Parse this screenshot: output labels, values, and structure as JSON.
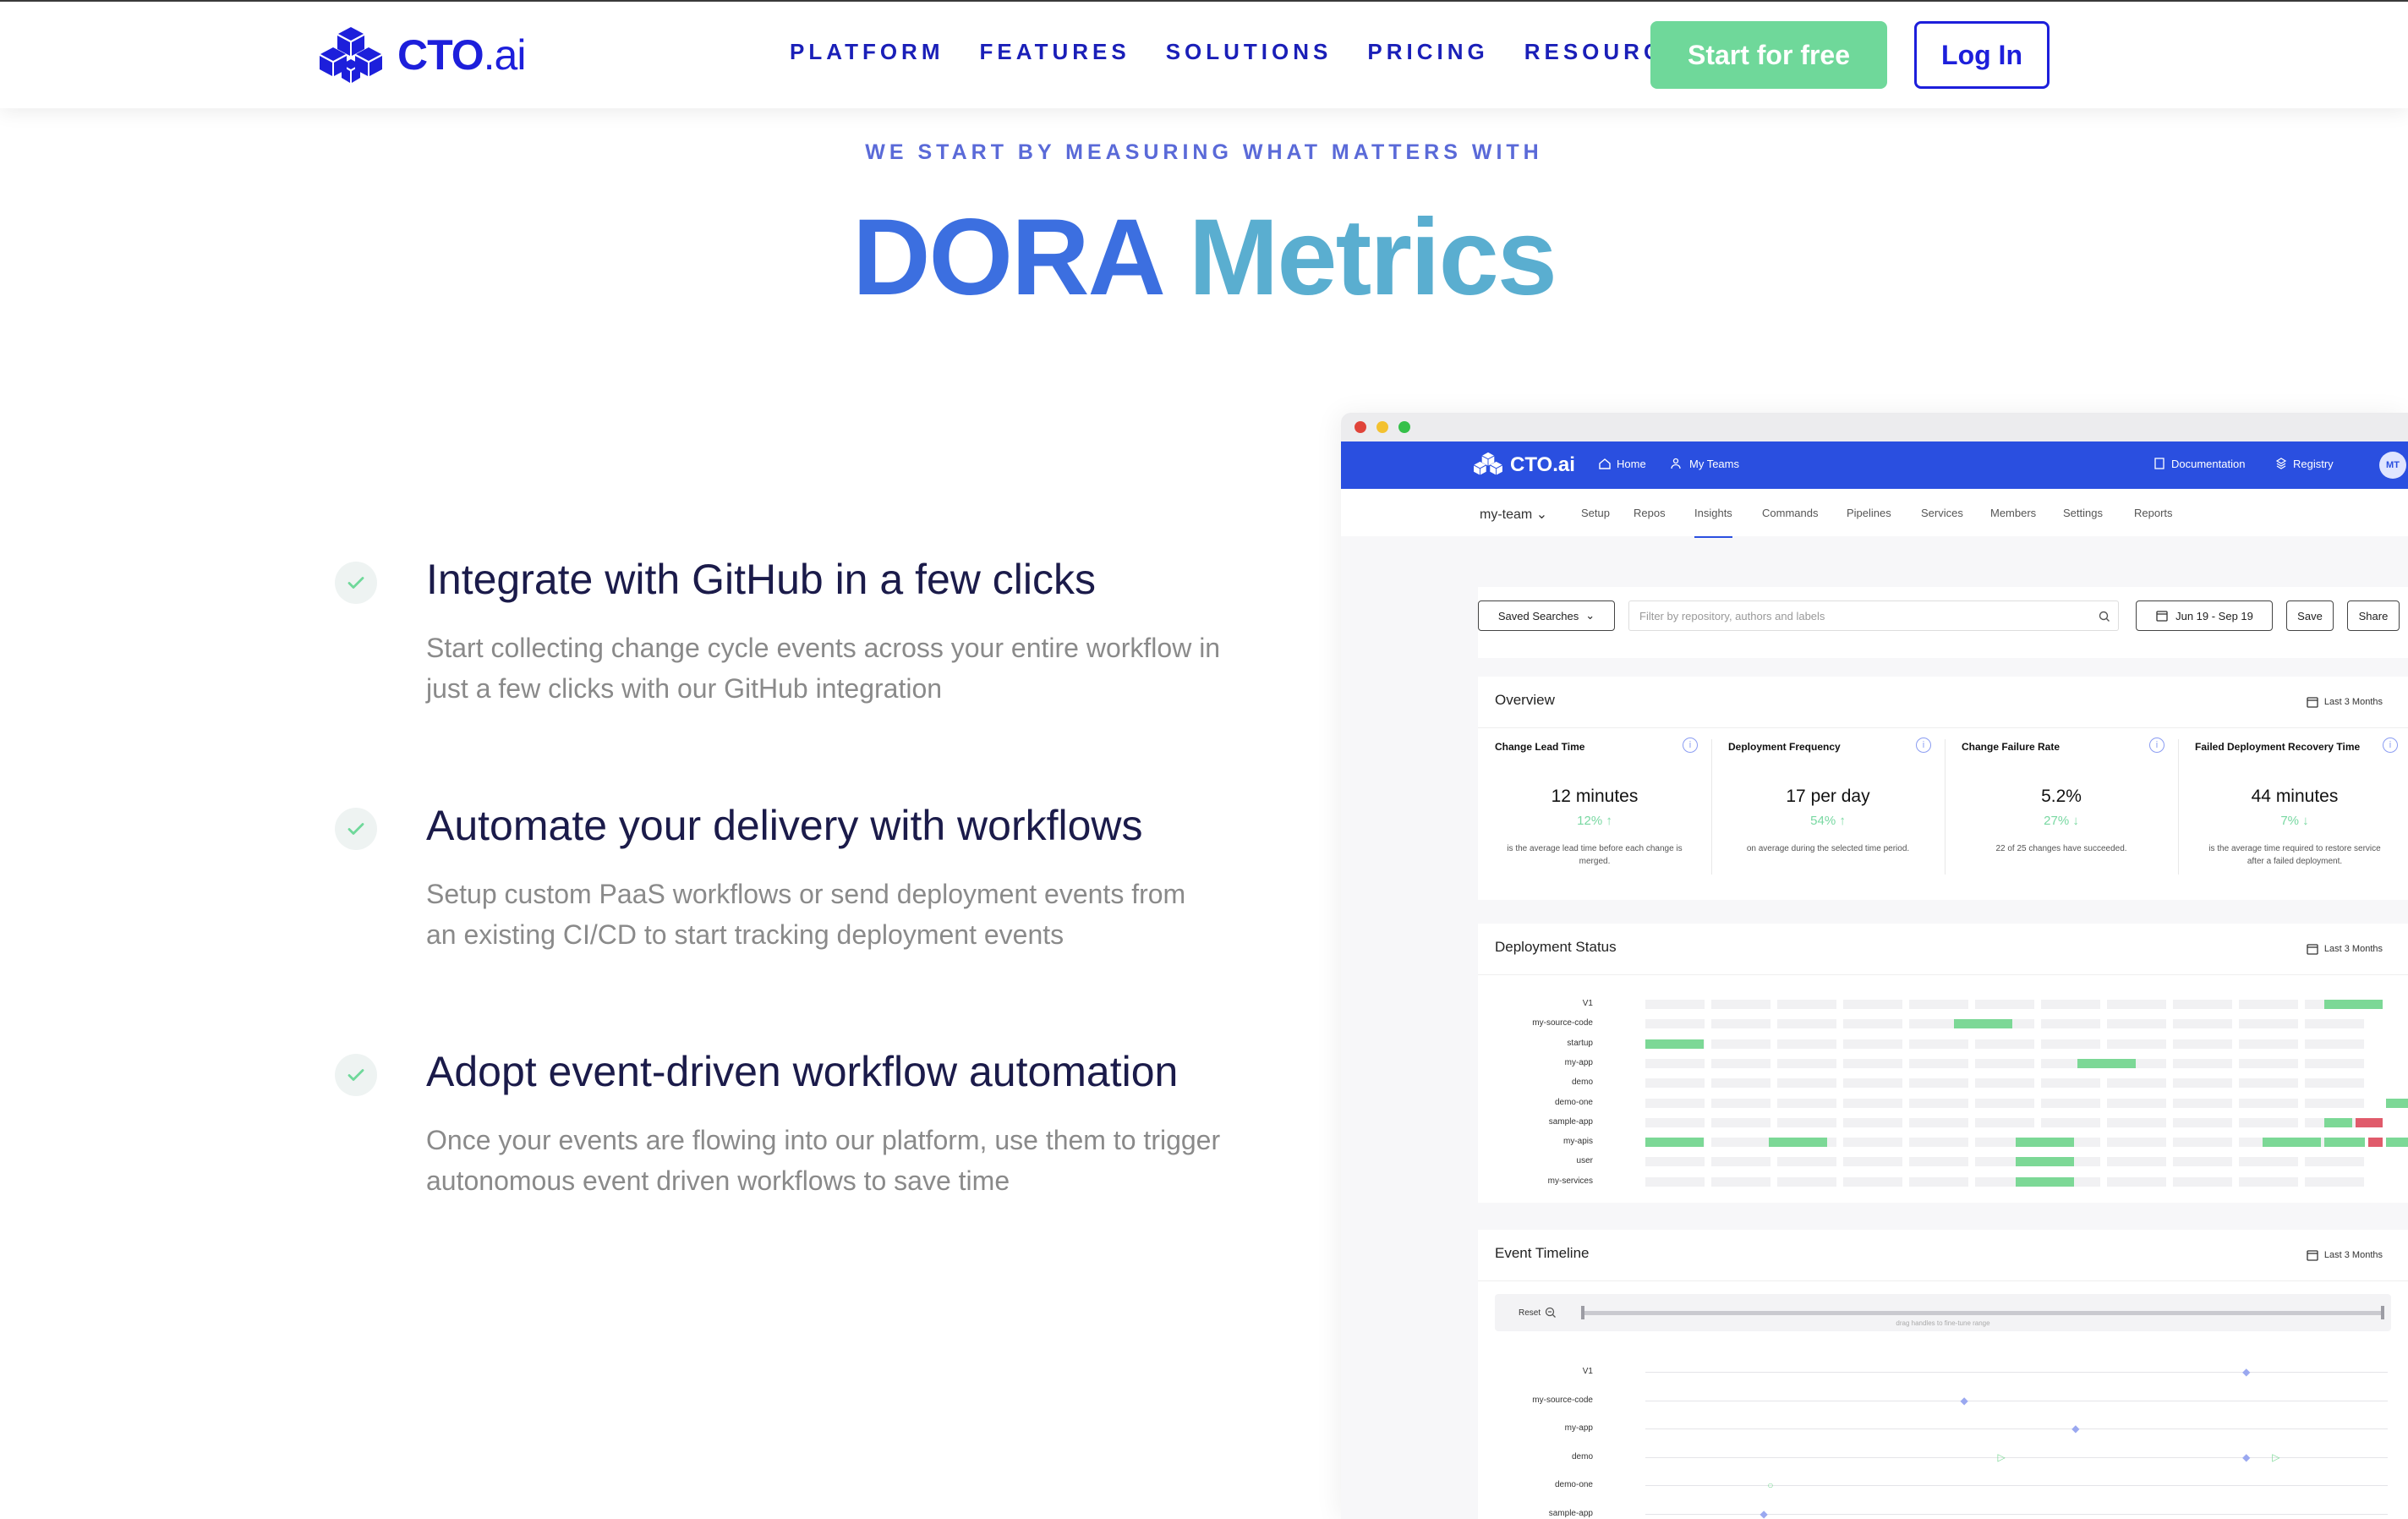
{
  "nav": {
    "logo_main": "CTO",
    "logo_suffix": ".ai",
    "links": [
      "PLATFORM",
      "FEATURES",
      "SOLUTIONS",
      "PRICING",
      "RESOURCES"
    ],
    "start_label": "Start for free",
    "login_label": "Log In",
    "accent": "#1d1fdb",
    "start_color": "#6fd89a"
  },
  "hero": {
    "eyebrow": "WE START BY MEASURING WHAT MATTERS WITH",
    "title_part1": "DORA",
    "title_part2": "Metrics"
  },
  "features": [
    {
      "icon": "check-icon",
      "title": "Integrate with GitHub in a few clicks",
      "desc": "Start collecting change cycle events across your entire workflow in just a few clicks with our GitHub integration"
    },
    {
      "icon": "check-icon",
      "title": "Automate your delivery with workflows",
      "desc": "Setup custom PaaS workflows or send deployment events from an existing CI/CD to start tracking deployment events"
    },
    {
      "icon": "check-icon",
      "title": "Adopt event-driven workflow automation",
      "desc": "Once your events are flowing into our platform, use them to trigger autonomous event driven workflows to save time"
    }
  ],
  "app": {
    "logo": "CTO.ai",
    "top_nav": {
      "home": "Home",
      "my_teams": "My Teams",
      "documentation": "Documentation",
      "registry": "Registry",
      "avatar": "MT"
    },
    "team": "my-team",
    "tabs": [
      "Setup",
      "Repos",
      "Insights",
      "Commands",
      "Pipelines",
      "Services",
      "Members",
      "Settings",
      "Reports"
    ],
    "active_tab": "Insights",
    "filters": {
      "saved_searches": "Saved Searches",
      "placeholder": "Filter by repository, authors and labels",
      "date_range": "Jun 19 - Sep 19",
      "save": "Save",
      "share": "Share"
    },
    "overview": {
      "title": "Overview",
      "range": "Last 3 Months",
      "metrics": [
        {
          "label": "Change Lead Time",
          "value": "12 minutes",
          "delta": "12%",
          "dir": "up",
          "note": "is the average lead time before each change is merged."
        },
        {
          "label": "Deployment Frequency",
          "value": "17 per day",
          "delta": "54%",
          "dir": "up",
          "note": "on average during the selected time period."
        },
        {
          "label": "Change Failure Rate",
          "value": "5.2%",
          "delta": "27%",
          "dir": "down",
          "note": "22 of 25 changes have succeeded."
        },
        {
          "label": "Failed Deployment Recovery Time",
          "value": "44 minutes",
          "delta": "7%",
          "dir": "down",
          "note": "is the average time required to restore service after a failed deployment."
        }
      ]
    },
    "deployment_status": {
      "title": "Deployment Status",
      "range": "Last 3 Months",
      "colors": {
        "success": "#7cd896",
        "failure": "#e05b6b"
      },
      "rows": [
        {
          "label": "V1",
          "bars": [
            [
              11,
              12,
              "success"
            ]
          ]
        },
        {
          "label": "my-source-code",
          "bars": [
            [
              5,
              6,
              "success"
            ]
          ]
        },
        {
          "label": "startup",
          "bars": [
            [
              0,
              1,
              "success"
            ]
          ]
        },
        {
          "label": "my-app",
          "bars": [
            [
              7,
              8,
              "success"
            ]
          ]
        },
        {
          "label": "demo",
          "bars": []
        },
        {
          "label": "demo-one",
          "bars": [
            [
              12,
              13,
              "success"
            ]
          ]
        },
        {
          "label": "sample-app",
          "bars": [
            [
              11,
              11.5,
              "success"
            ],
            [
              11.5,
              12,
              "failure"
            ]
          ]
        },
        {
          "label": "my-apis",
          "bars": [
            [
              0,
              1,
              "success"
            ],
            [
              2,
              3,
              "success"
            ],
            [
              6,
              7,
              "success"
            ],
            [
              10,
              11,
              "success"
            ],
            [
              11,
              11.7,
              "success"
            ],
            [
              11.7,
              12,
              "failure"
            ],
            [
              12,
              13,
              "success"
            ]
          ]
        },
        {
          "label": "user",
          "bars": [
            [
              6,
              7,
              "success"
            ]
          ]
        },
        {
          "label": "my-services",
          "bars": [
            [
              6,
              7,
              "success"
            ]
          ]
        }
      ]
    },
    "event_timeline": {
      "title": "Event Timeline",
      "range": "Last 3 Months",
      "reset": "Reset",
      "hint": "drag handles to fine-tune range",
      "rows": [
        {
          "label": "V1",
          "markers": [
            [
              0.81,
              "diamond",
              "#9aa8f0"
            ]
          ]
        },
        {
          "label": "my-source-code",
          "markers": [
            [
              0.43,
              "diamond",
              "#9aa8f0"
            ]
          ]
        },
        {
          "label": "my-app",
          "markers": [
            [
              0.58,
              "diamond",
              "#9aa8f0"
            ]
          ]
        },
        {
          "label": "demo",
          "markers": [
            [
              0.48,
              "play",
              "#7cd896"
            ],
            [
              0.81,
              "diamond",
              "#9aa8f0"
            ],
            [
              0.85,
              "play",
              "#7cd896"
            ]
          ]
        },
        {
          "label": "demo-one",
          "markers": [
            [
              0.17,
              "circle",
              "#7cd896"
            ]
          ]
        },
        {
          "label": "sample-app",
          "markers": [
            [
              0.16,
              "diamond",
              "#9aa8f0"
            ]
          ]
        }
      ]
    }
  }
}
